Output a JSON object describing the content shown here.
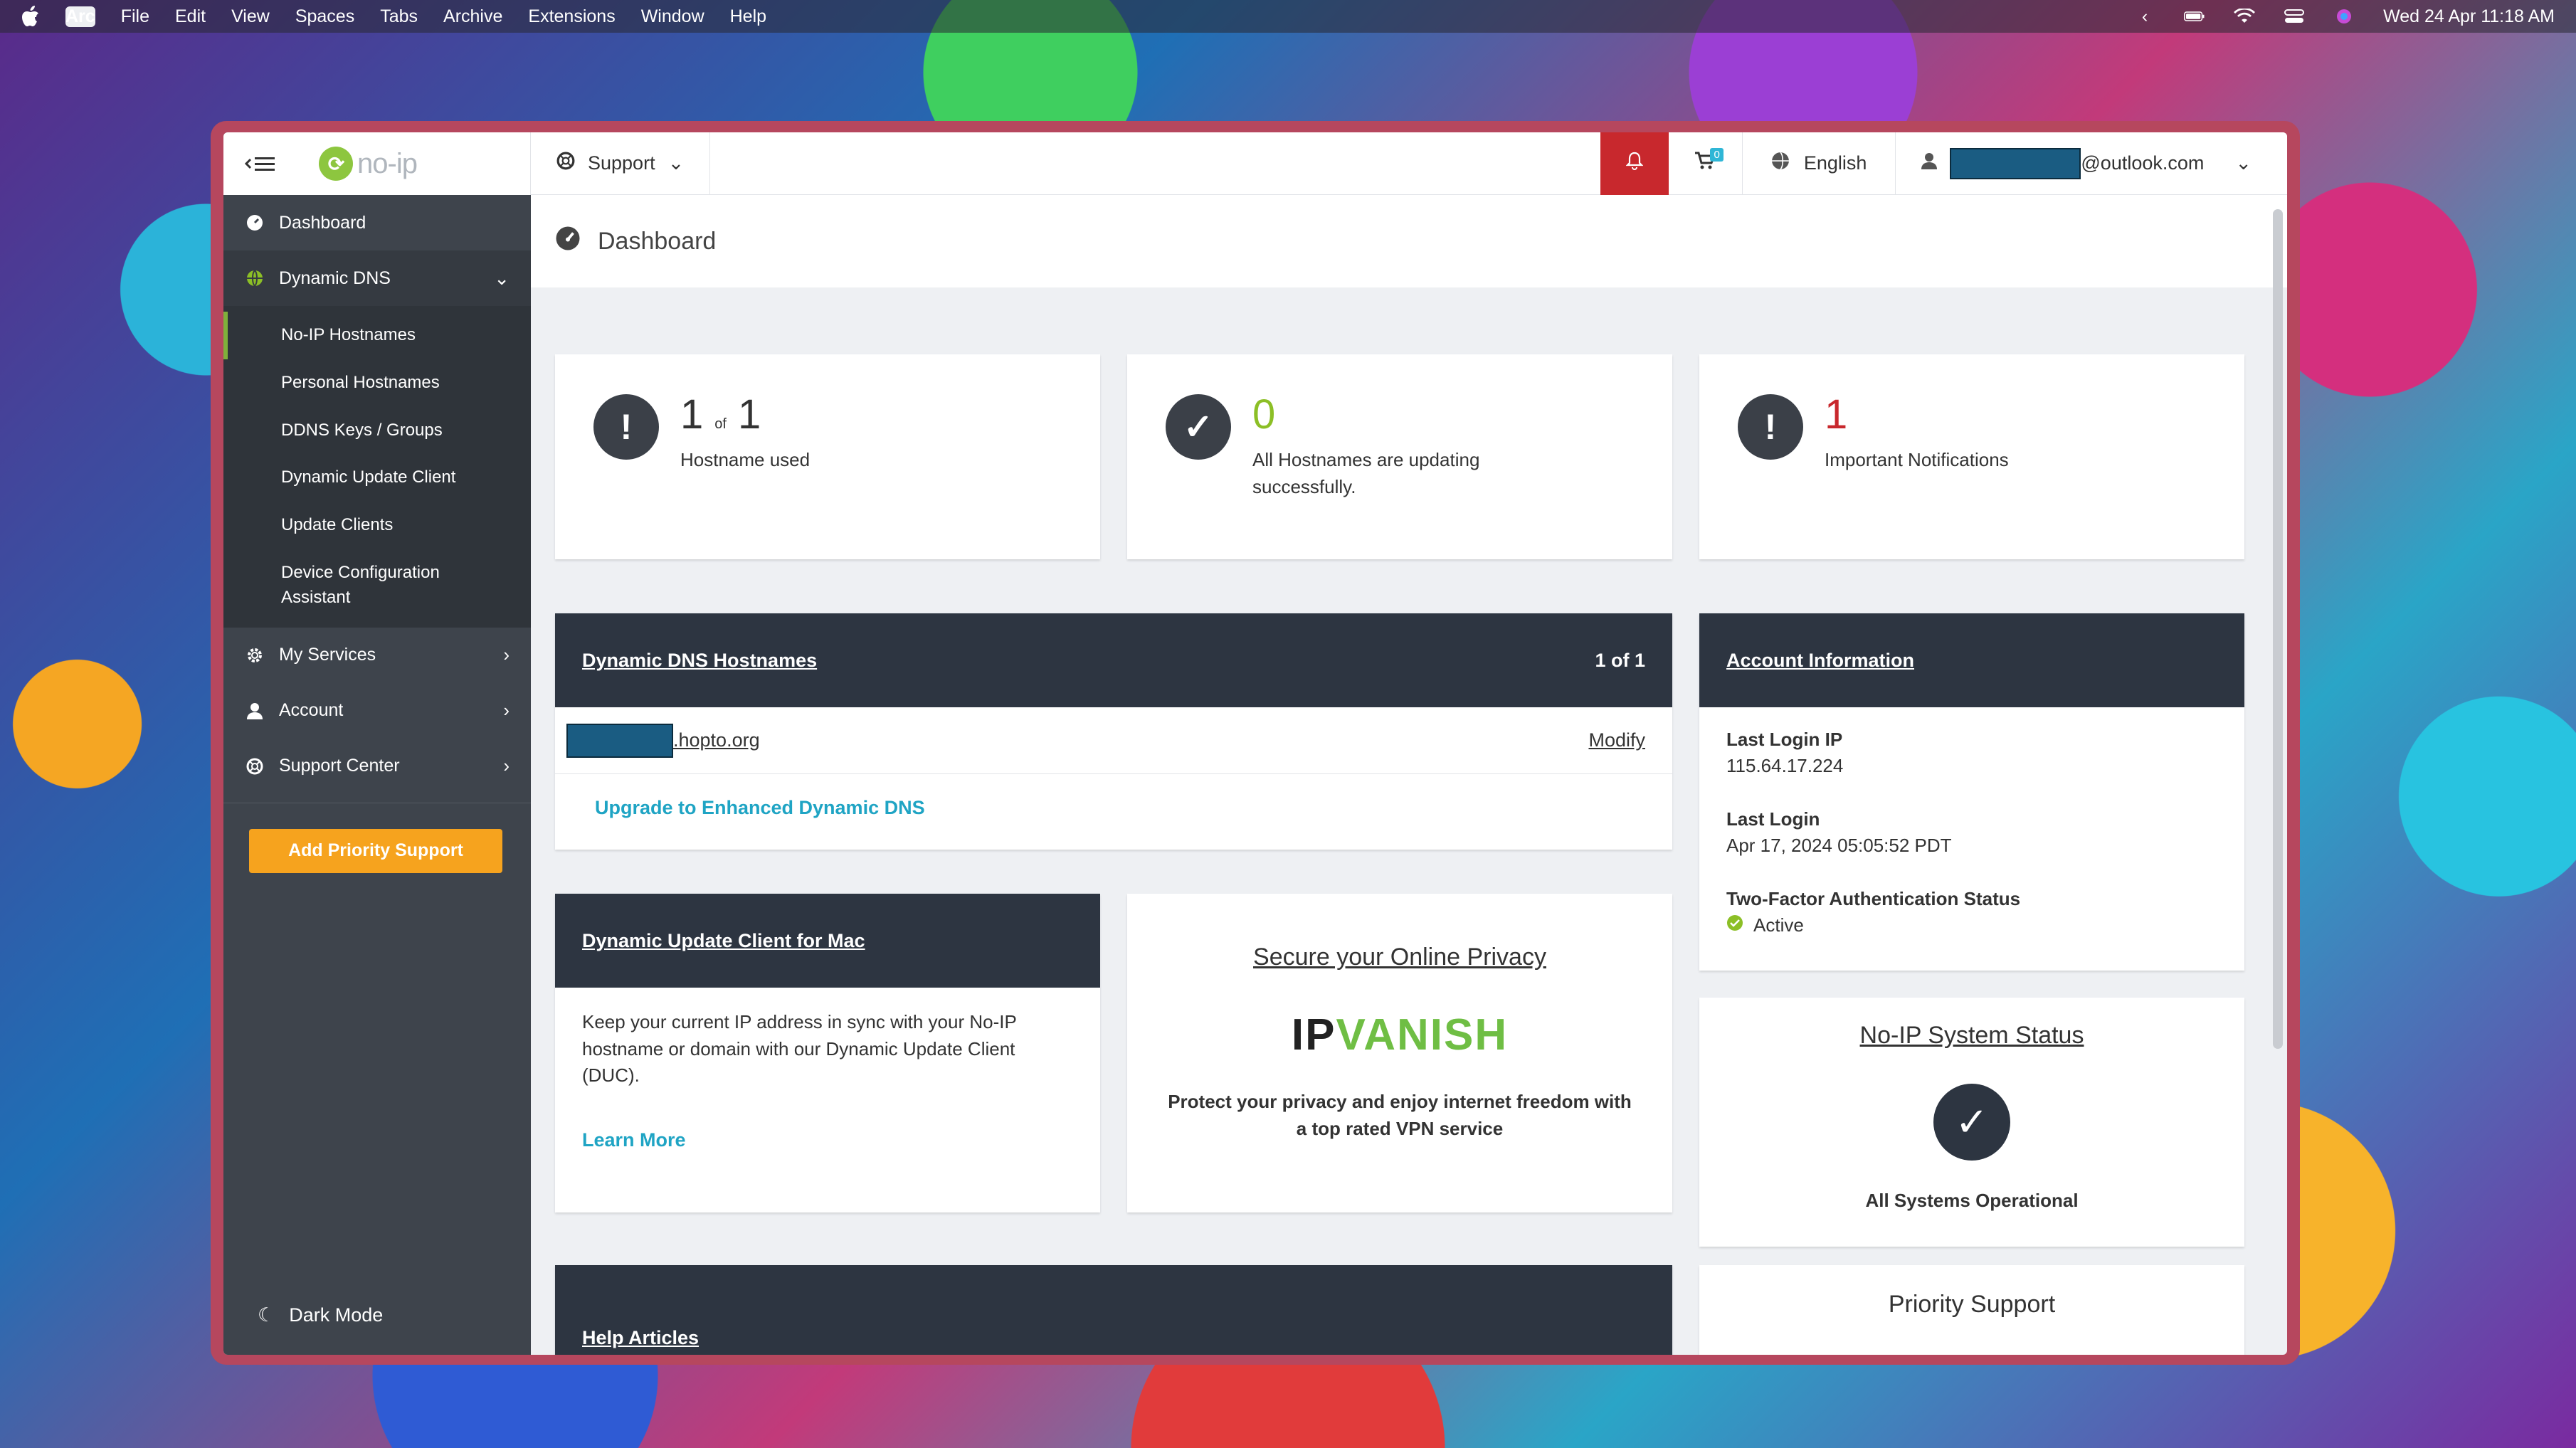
{
  "menubar": {
    "app": "Arc",
    "items": [
      "File",
      "Edit",
      "View",
      "Spaces",
      "Tabs",
      "Archive",
      "Extensions",
      "Window",
      "Help"
    ],
    "datetime": "Wed 24 Apr  11:18 AM"
  },
  "sidebar": {
    "logo": "no-ip",
    "items": [
      {
        "label": "Dashboard",
        "icon": "dashboard-icon"
      },
      {
        "label": "Dynamic DNS",
        "icon": "globe-icon"
      },
      {
        "label": "My Services",
        "icon": "gear-icon"
      },
      {
        "label": "Account",
        "icon": "user-icon"
      },
      {
        "label": "Support Center",
        "icon": "lifebuoy-icon"
      }
    ],
    "dns_sub": [
      "No-IP Hostnames",
      "Personal Hostnames",
      "DDNS Keys / Groups",
      "Dynamic Update Client",
      "Update Clients",
      "Device Configuration Assistant"
    ],
    "priority_button": "Add Priority Support",
    "dark_mode": "Dark Mode"
  },
  "topbar": {
    "support": "Support",
    "cart_count": "0",
    "language": "English",
    "email_suffix": "@outlook.com"
  },
  "page": {
    "title": "Dashboard"
  },
  "stats": {
    "used": "1",
    "of": "of",
    "total": "1",
    "used_label": "Hostname used",
    "updating_count": "0",
    "updating_label": "All Hostnames are updating successfully.",
    "notif_count": "1",
    "notif_label": "Important Notifications"
  },
  "hostnames": {
    "title": "Dynamic DNS Hostnames",
    "count": "1 of 1",
    "domain_suffix": ".hopto.org",
    "modify": "Modify",
    "upgrade": "Upgrade to Enhanced Dynamic DNS"
  },
  "account": {
    "title": "Account Information",
    "last_ip_label": "Last Login IP",
    "last_ip": "115.64.17.224",
    "last_login_label": "Last Login",
    "last_login": "Apr 17, 2024 05:05:52 PDT",
    "tfa_label": "Two-Factor Authentication Status",
    "tfa_status": "Active"
  },
  "duc": {
    "title": "Dynamic Update Client for Mac",
    "text": "Keep your current IP address in sync with your No-IP hostname or domain with our Dynamic Update Client (DUC).",
    "link": "Learn More"
  },
  "promo": {
    "title": "Secure your Online Privacy",
    "brand_ip": "IP",
    "brand_vanish": "VANISH",
    "text": "Protect your privacy and enjoy internet freedom with a top rated VPN service"
  },
  "system": {
    "title": "No-IP System Status",
    "status": "All Systems Operational"
  },
  "help": {
    "title": "Help Articles"
  },
  "priority": {
    "title": "Priority Support"
  },
  "colors": {
    "accent_green": "#8cbf26",
    "alert_red": "#c8282d",
    "teal": "#1fa4c4",
    "orange": "#f6a31e"
  }
}
